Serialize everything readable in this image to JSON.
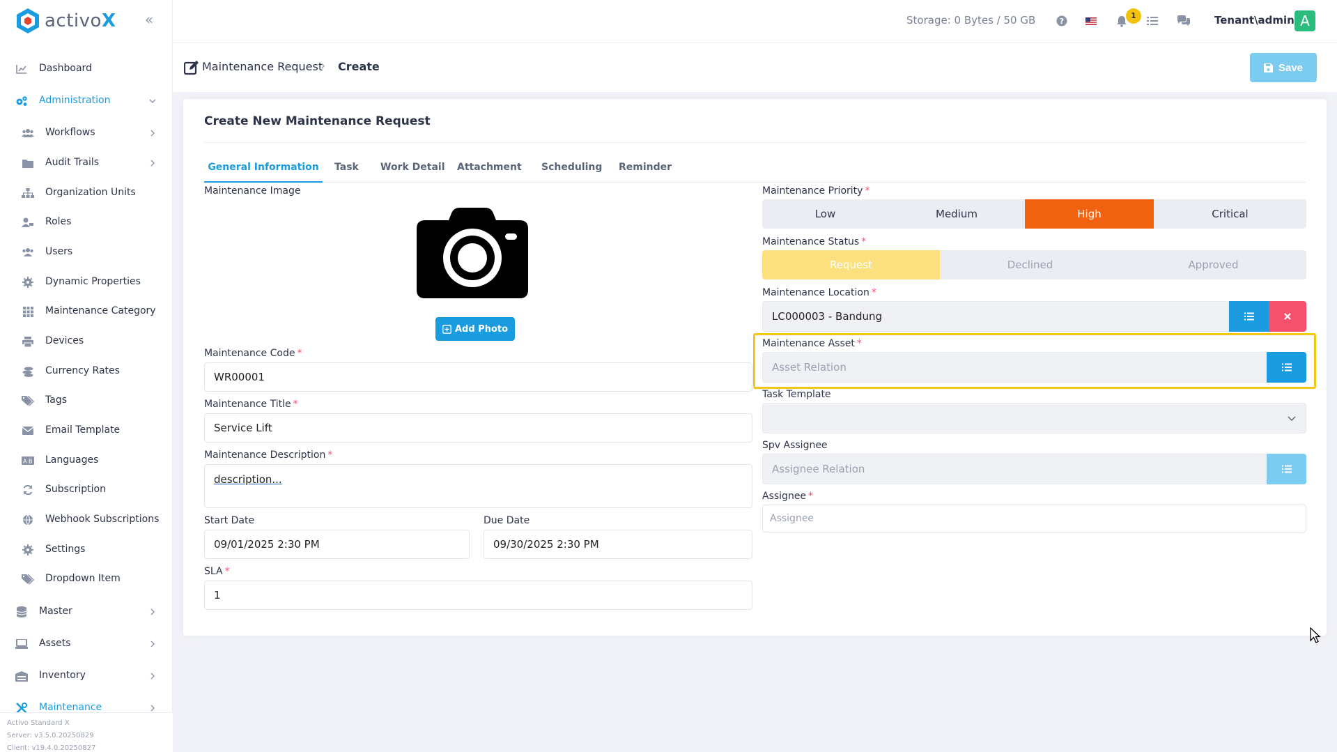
{
  "brand": {
    "name": "activo",
    "suffix": "X"
  },
  "sidebar": {
    "items": [
      {
        "label": "Dashboard"
      },
      {
        "label": "Administration"
      },
      {
        "label": "Workflows"
      },
      {
        "label": "Audit Trails"
      },
      {
        "label": "Organization Units"
      },
      {
        "label": "Roles"
      },
      {
        "label": "Users"
      },
      {
        "label": "Dynamic Properties"
      },
      {
        "label": "Maintenance Category"
      },
      {
        "label": "Devices"
      },
      {
        "label": "Currency Rates"
      },
      {
        "label": "Tags"
      },
      {
        "label": "Email Template"
      },
      {
        "label": "Languages"
      },
      {
        "label": "Subscription"
      },
      {
        "label": "Webhook Subscriptions"
      },
      {
        "label": "Settings"
      },
      {
        "label": "Dropdown Item"
      },
      {
        "label": "Master"
      },
      {
        "label": "Assets"
      },
      {
        "label": "Inventory"
      },
      {
        "label": "Maintenance"
      }
    ],
    "footer": {
      "product": "Activo Standard X",
      "server": "Server: v3.5.0.20250829",
      "client": "Client: v19.4.0.20250827"
    }
  },
  "topbar": {
    "storage": "Storage: 0 Bytes / 50 GB",
    "notification_count": "1",
    "user": "Tenant\\admin",
    "avatar_letter": "A"
  },
  "subheader": {
    "breadcrumb_parent": "Maintenance Request",
    "breadcrumb_sep": "›",
    "breadcrumb_current": "Create",
    "save_label": "Save"
  },
  "form": {
    "title": "Create New Maintenance Request",
    "tabs": [
      {
        "label": "General Information"
      },
      {
        "label": "Task"
      },
      {
        "label": "Work Detail"
      },
      {
        "label": "Attachment"
      },
      {
        "label": "Scheduling"
      },
      {
        "label": "Reminder"
      }
    ],
    "image_label": "Maintenance Image",
    "add_photo_label": "Add Photo",
    "code": {
      "label": "Maintenance Code",
      "value": "WR00001"
    },
    "title_field": {
      "label": "Maintenance Title",
      "value": "Service Lift"
    },
    "description": {
      "label": "Maintenance Description",
      "value": "description..."
    },
    "start_date": {
      "label": "Start Date",
      "value": "09/01/2025 2:30 PM"
    },
    "due_date": {
      "label": "Due Date",
      "value": "09/30/2025 2:30 PM"
    },
    "sla": {
      "label": "SLA",
      "value": "1"
    },
    "priority": {
      "label": "Maintenance Priority",
      "options": [
        "Low",
        "Medium",
        "High",
        "Critical"
      ],
      "selected": "High"
    },
    "status": {
      "label": "Maintenance Status",
      "options": [
        "Request",
        "Declined",
        "Approved"
      ],
      "selected": "Request"
    },
    "location": {
      "label": "Maintenance Location",
      "value": "LC000003 - Bandung"
    },
    "asset": {
      "label": "Maintenance Asset",
      "placeholder": "Asset Relation"
    },
    "task_template": {
      "label": "Task Template",
      "value": ""
    },
    "spv_assignee": {
      "label": "Spv Assignee",
      "placeholder": "Assignee Relation"
    },
    "assignee": {
      "label": "Assignee",
      "placeholder": "Assignee"
    }
  },
  "colors": {
    "accent": "#1b9be0",
    "priority_selected": "#f0620f",
    "status_selected": "#fbe07d",
    "danger": "#f4516c",
    "highlight": "#f5c518",
    "avatar": "#2bbd7e"
  }
}
